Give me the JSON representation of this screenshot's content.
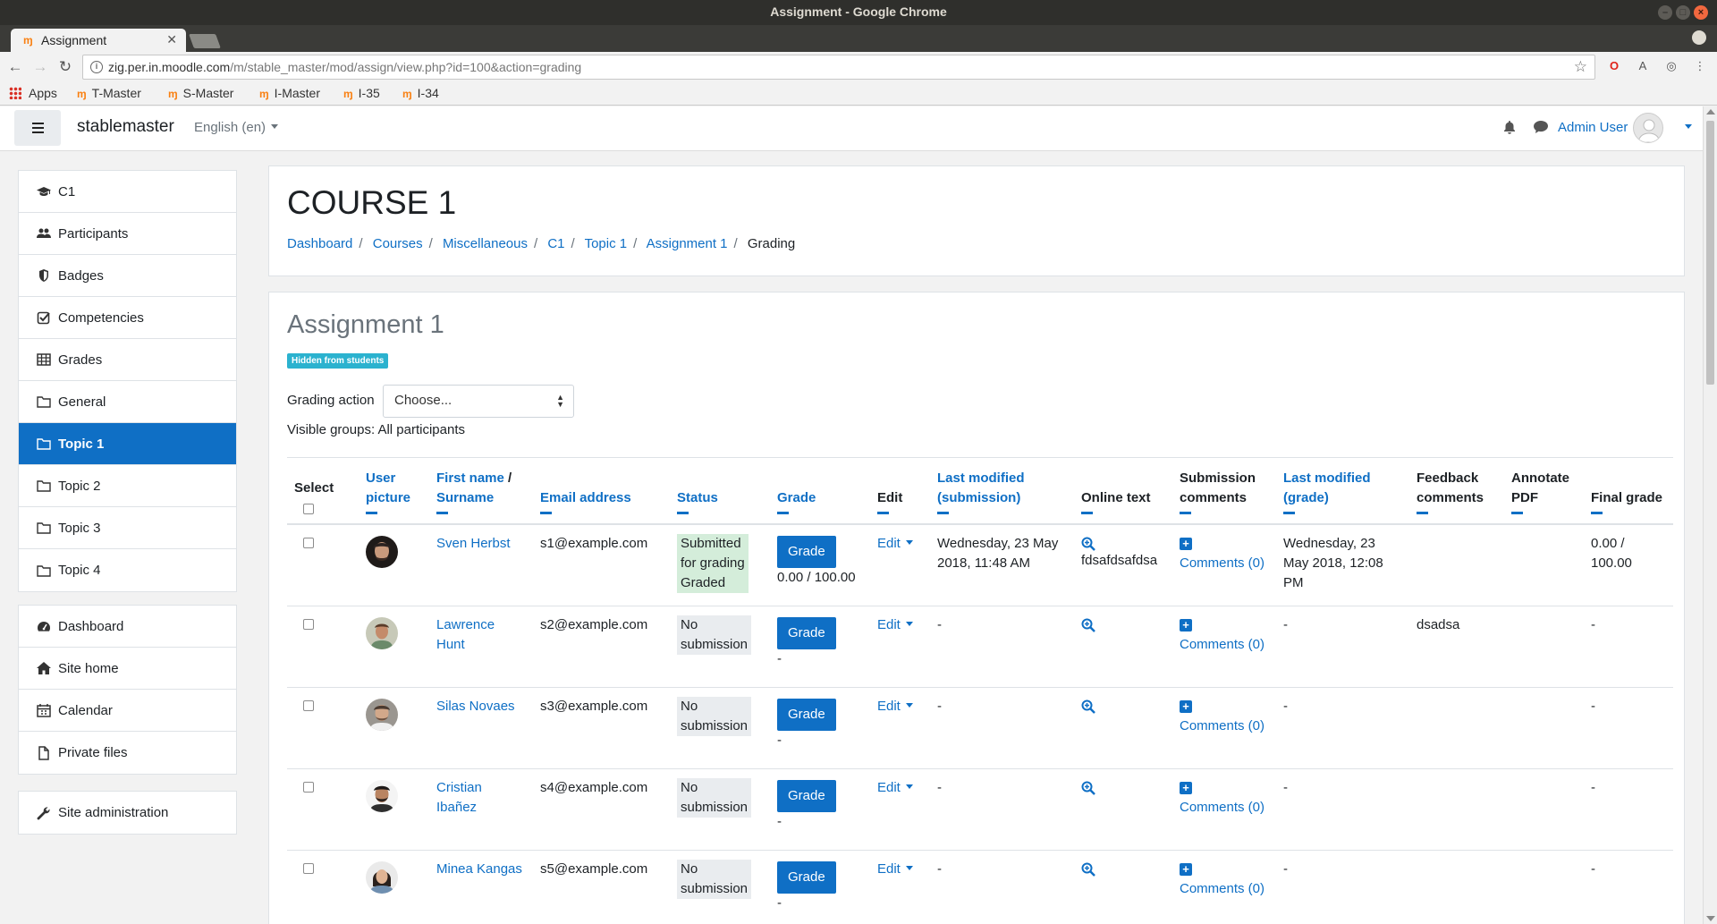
{
  "window": {
    "title": "Assignment - Google Chrome"
  },
  "browser": {
    "tab_title": "Assignment",
    "tab_favicon": "m",
    "url_host": "zig.per.in.moodle.com",
    "url_path": "/m/stable_master/mod/assign/view.php?id=100&action=grading",
    "bookmarks": [
      {
        "label": "Apps",
        "icon": "apps-grid-icon"
      },
      {
        "label": "T-Master",
        "icon": "moodle-icon"
      },
      {
        "label": "S-Master",
        "icon": "moodle-icon"
      },
      {
        "label": "I-Master",
        "icon": "moodle-icon"
      },
      {
        "label": "I-35",
        "icon": "moodle-icon"
      },
      {
        "label": "I-34",
        "icon": "moodle-icon"
      }
    ]
  },
  "navbar": {
    "site_name": "stablemaster",
    "language": "English (en)",
    "user_name": "Admin User"
  },
  "sidebar": {
    "course_items": [
      {
        "label": "C1",
        "icon": "graduation-cap-icon"
      },
      {
        "label": "Participants",
        "icon": "users-icon"
      },
      {
        "label": "Badges",
        "icon": "shield-icon"
      },
      {
        "label": "Competencies",
        "icon": "check-square-icon"
      },
      {
        "label": "Grades",
        "icon": "table-icon"
      },
      {
        "label": "General",
        "icon": "folder-icon"
      },
      {
        "label": "Topic 1",
        "icon": "folder-icon",
        "active": true
      },
      {
        "label": "Topic 2",
        "icon": "folder-icon"
      },
      {
        "label": "Topic 3",
        "icon": "folder-icon"
      },
      {
        "label": "Topic 4",
        "icon": "folder-icon"
      }
    ],
    "site_items": [
      {
        "label": "Dashboard",
        "icon": "tachometer-icon"
      },
      {
        "label": "Site home",
        "icon": "home-icon"
      },
      {
        "label": "Calendar",
        "icon": "calendar-icon"
      },
      {
        "label": "Private files",
        "icon": "file-icon"
      }
    ],
    "admin_items": [
      {
        "label": "Site administration",
        "icon": "wrench-icon"
      }
    ]
  },
  "header": {
    "title": "COURSE 1",
    "breadcrumb": [
      "Dashboard",
      "Courses",
      "Miscellaneous",
      "C1",
      "Topic 1",
      "Assignment 1",
      "Grading"
    ]
  },
  "assignment": {
    "title": "Assignment 1",
    "badge": "Hidden from students",
    "grading_action_label": "Grading action",
    "grading_action_value": "Choose...",
    "visible_groups": "Visible groups: All participants"
  },
  "table": {
    "headers": {
      "select": "Select",
      "user_picture_1": "User",
      "user_picture_2": "picture",
      "name_first": "First name",
      "name_sep": " / ",
      "name_surname": "Surname",
      "email": "Email address",
      "status": "Status",
      "grade": "Grade",
      "edit": "Edit",
      "last_mod_sub_1": "Last modified",
      "last_mod_sub_2": "(submission)",
      "online_text": "Online text",
      "sub_comments_1": "Submission",
      "sub_comments_2": "comments",
      "last_mod_grade_1": "Last modified",
      "last_mod_grade_2": "(grade)",
      "feedback_1": "Feedback",
      "feedback_2": "comments",
      "annotate_1": "Annotate",
      "annotate_2": "PDF",
      "final_grade": "Final grade"
    },
    "grade_button": "Grade",
    "edit_label": "Edit",
    "rows": [
      {
        "name": "Sven Herbst",
        "email": "s1@example.com",
        "status_1": "Submitted",
        "status_2": "for grading",
        "status_3": "Graded",
        "grade_value": "0.00 / 100.00",
        "last_mod_sub": "Wednesday, 23 May 2018, 11:48 AM",
        "online_text": "fdsafdsafdsa",
        "comments": "Comments (0)",
        "last_mod_grade": "Wednesday, 23 May 2018, 12:08 PM",
        "feedback": "",
        "final_grade": "0.00 / 100.00"
      },
      {
        "name": "Lawrence Hunt",
        "email": "s2@example.com",
        "status_1": "No",
        "status_2": "submission",
        "grade_value": "-",
        "last_mod_sub": "-",
        "online_text": "",
        "comments": "Comments (0)",
        "last_mod_grade": "-",
        "feedback": "dsadsa",
        "final_grade": "-"
      },
      {
        "name": "Silas Novaes",
        "email": "s3@example.com",
        "status_1": "No",
        "status_2": "submission",
        "grade_value": "-",
        "last_mod_sub": "-",
        "online_text": "",
        "comments": "Comments (0)",
        "last_mod_grade": "-",
        "feedback": "",
        "final_grade": "-"
      },
      {
        "name": "Cristian Ibañez",
        "email": "s4@example.com",
        "status_1": "No",
        "status_2": "submission",
        "grade_value": "-",
        "last_mod_sub": "-",
        "online_text": "",
        "comments": "Comments (0)",
        "last_mod_grade": "-",
        "feedback": "",
        "final_grade": "-"
      },
      {
        "name": "Minea Kangas",
        "email": "s5@example.com",
        "status_1": "No",
        "status_2": "submission",
        "grade_value": "-",
        "last_mod_sub": "-",
        "online_text": "",
        "comments": "Comments (0)",
        "last_mod_grade": "-",
        "feedback": "",
        "final_grade": "-"
      }
    ]
  },
  "colors": {
    "primary": "#0f6fc5",
    "badge": "#2bb2cf",
    "status_submitted": "#d4edda",
    "status_none": "#e9ecef"
  }
}
